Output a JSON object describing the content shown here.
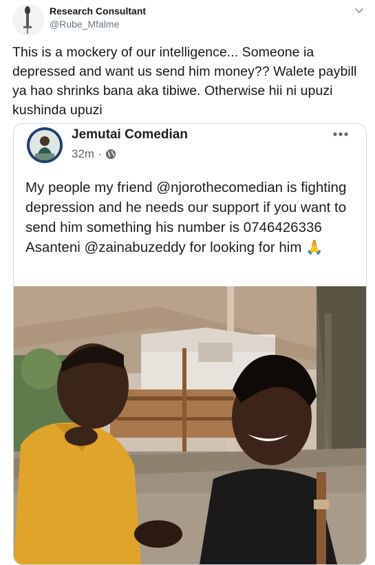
{
  "tweet": {
    "author_name": "Research Consultant",
    "author_handle": "@Rube_Mfalme",
    "text": "This is a mockery of our intelligence... Someone ia depressed and want us send him money?? Walete paybill ya hao shrinks bana aka tibiwe.  Otherwise hii ni upuzi kushinda upuzi",
    "icons": {
      "menu": "chevron-down-icon"
    },
    "colors": {
      "text": "#14171a",
      "secondary": "#657786",
      "border": "#cfd9de"
    }
  },
  "embedded_post": {
    "author_name": "Jemutai Comedian",
    "time": "32m",
    "separator": "·",
    "text": "My people my friend @njorothecomedian is fighting depression and he needs our support if you want to send him something his number is 0746426336 Asanteni @zainabuzeddy for looking for him",
    "emoji": "🙏",
    "icons": {
      "audience": "globe-icon",
      "more": "more-options-icon"
    },
    "photo_alt": "Man in yellow shirt and woman in black top smiling under a shaded outdoor area"
  }
}
